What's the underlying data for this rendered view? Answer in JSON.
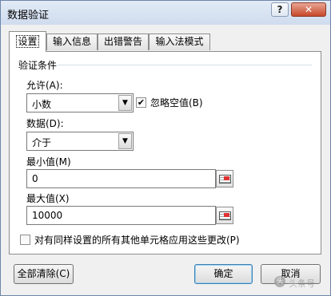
{
  "window": {
    "title": "数据验证",
    "help": "?",
    "close": "✕"
  },
  "tabs": [
    "设置",
    "输入信息",
    "出错警告",
    "输入法模式"
  ],
  "criteria": {
    "group_label": "验证条件",
    "allow_label": "允许(A):",
    "allow_value": "小数",
    "ignore_blank_label": "忽略空值(B)",
    "ignore_blank_checked": true,
    "data_label": "数据(D):",
    "data_value": "介于",
    "min_label": "最小值(M)",
    "min_value": "0",
    "max_label": "最大值(X)",
    "max_value": "10000"
  },
  "apply_all_label": "对有同样设置的所有其他单元格应用这些更改(P)",
  "apply_all_checked": false,
  "buttons": {
    "clear_all": "全部清除(C)",
    "ok": "确定",
    "cancel": "取消"
  },
  "watermark": "头条号"
}
